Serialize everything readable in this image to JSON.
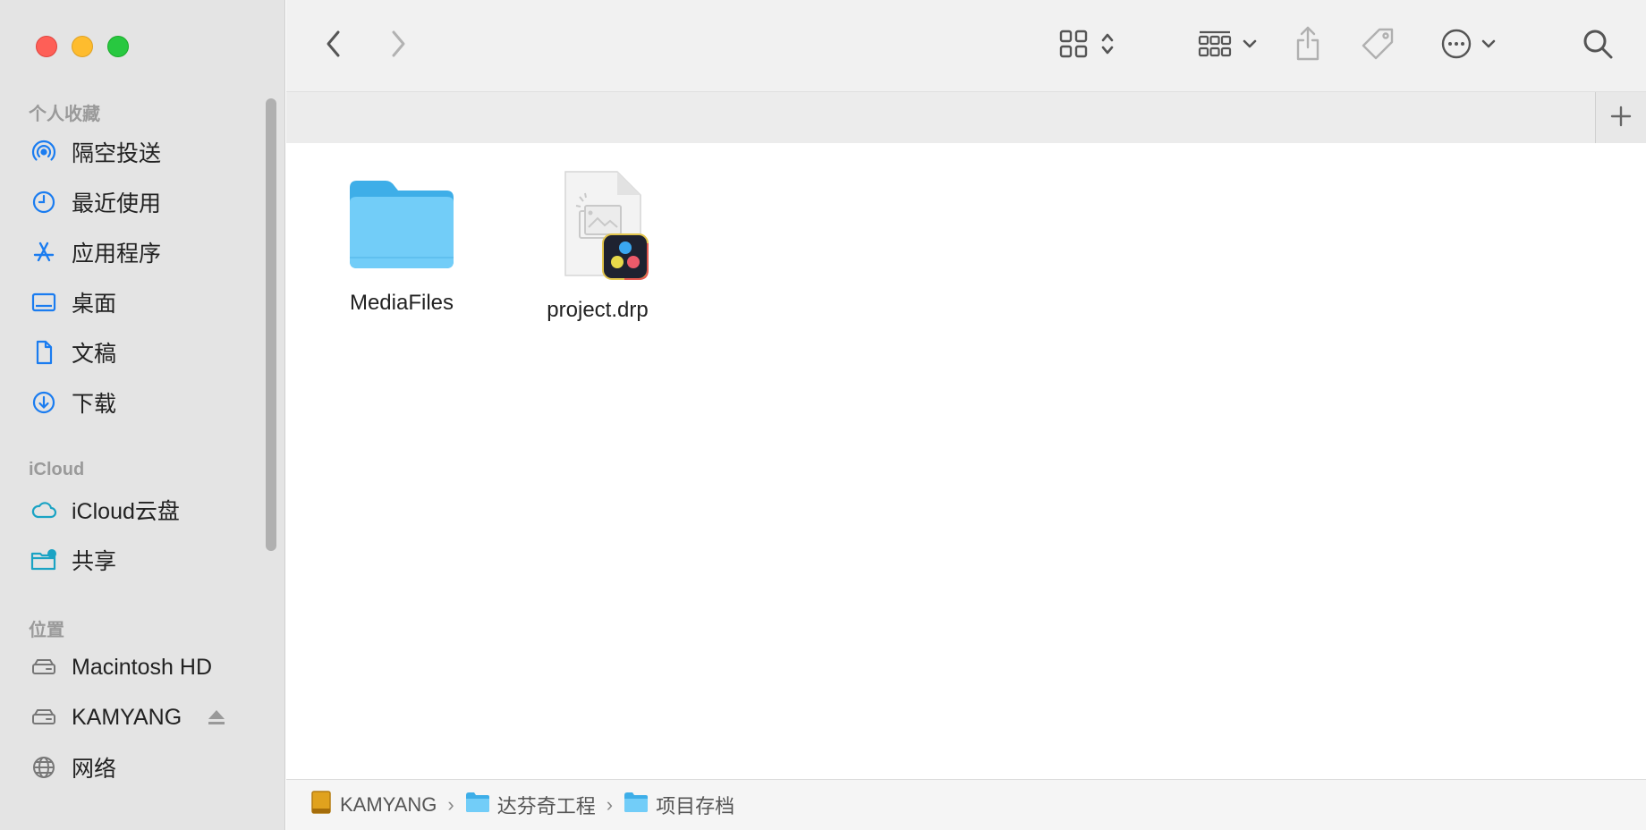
{
  "sidebar": {
    "sections": [
      {
        "title": "个人收藏",
        "items": [
          {
            "label": "隔空投送",
            "icon": "airdrop-icon"
          },
          {
            "label": "最近使用",
            "icon": "clock-icon"
          },
          {
            "label": "应用程序",
            "icon": "applications-icon"
          },
          {
            "label": "桌面",
            "icon": "desktop-icon"
          },
          {
            "label": "文稿",
            "icon": "document-icon"
          },
          {
            "label": "下载",
            "icon": "download-icon"
          }
        ]
      },
      {
        "title": "iCloud",
        "items": [
          {
            "label": "iCloud云盘",
            "icon": "cloud-icon"
          },
          {
            "label": "共享",
            "icon": "shared-folder-icon"
          }
        ]
      },
      {
        "title": "位置",
        "items": [
          {
            "label": "Macintosh HD",
            "icon": "drive-icon"
          },
          {
            "label": "KAMYANG",
            "icon": "drive-icon"
          },
          {
            "label": "网络",
            "icon": "network-icon"
          }
        ]
      }
    ]
  },
  "toolbar": {
    "icons": [
      "chevron-left-icon",
      "chevron-right-icon",
      "grid-view-icon",
      "group-icon",
      "share-icon",
      "tag-icon",
      "more-icon",
      "search-icon"
    ]
  },
  "files": [
    {
      "name": "MediaFiles",
      "kind": "folder"
    },
    {
      "name": "project.drp",
      "kind": "davinci-project"
    }
  ],
  "pathbar": {
    "segments": [
      {
        "label": "KAMYANG",
        "icon": "drive-icon"
      },
      {
        "label": "达芬奇工程",
        "icon": "folder-icon"
      },
      {
        "label": "项目存档",
        "icon": "folder-icon"
      }
    ]
  },
  "colors": {
    "accent": "#1a7cf0",
    "folder": "#6ccbf7",
    "sidebar_bg": "#e4e4e4"
  }
}
